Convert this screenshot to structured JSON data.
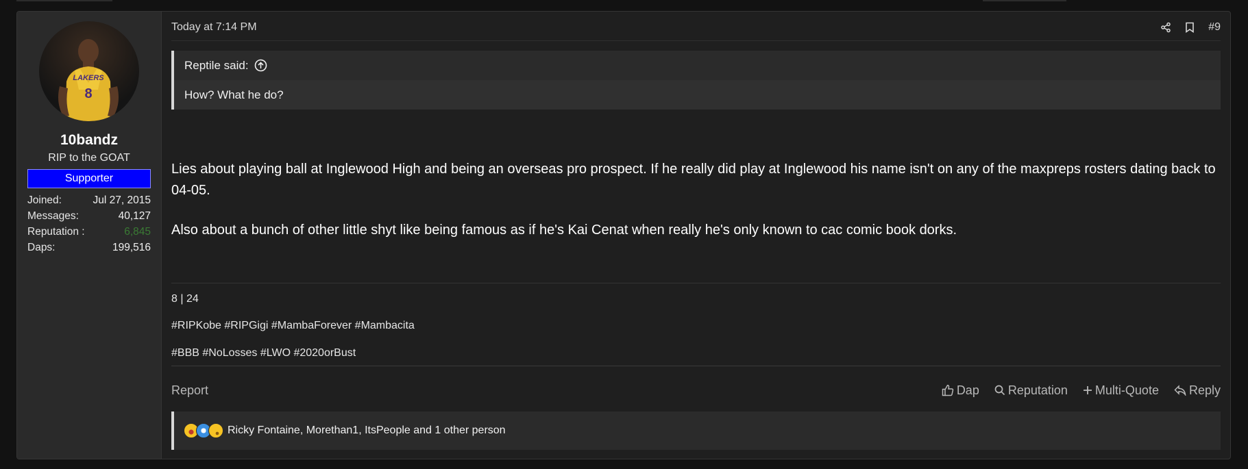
{
  "user": {
    "username": "10bandz",
    "title": "RIP to the GOAT",
    "banner": "Supporter",
    "stats": [
      {
        "label": "Joined:",
        "value": "Jul 27, 2015"
      },
      {
        "label": "Messages:",
        "value": "40,127"
      },
      {
        "label": "Reputation :",
        "value": "6,845"
      },
      {
        "label": "Daps:",
        "value": "199,516"
      }
    ],
    "avatar_text": "LAKERS",
    "avatar_number": "8"
  },
  "post": {
    "timestamp": "Today at 7:14 PM",
    "number": "#9",
    "quote": {
      "author": "Reptile said:",
      "text": "How? What he do?"
    },
    "message": [
      "Lies about playing ball at Inglewood High and being an overseas pro prospect. If he really did play at Inglewood his name isn't on any of the maxpreps rosters dating back to 04-05.",
      "Also about a bunch of other little shyt like being famous as if he's Kai Cenat when really he's only known to cac comic book dorks."
    ],
    "signature": [
      "8 | 24",
      "#RIPKobe #RIPGigi #MambaForever #Mambacita",
      "#BBB #NoLosses #LWO #2020orBust"
    ]
  },
  "actions": {
    "report": "Report",
    "dap": "Dap",
    "reputation": "Reputation",
    "multiquote": "Multi-Quote",
    "reply": "Reply"
  },
  "reactions": {
    "text": "Ricky Fontaine, Morethan1, ItsPeople and 1 other person"
  },
  "colors": {
    "banner": "#0000ff",
    "reputation_value": "#3a7a34",
    "background": "#121212",
    "post_bg": "#1f1f1f"
  }
}
